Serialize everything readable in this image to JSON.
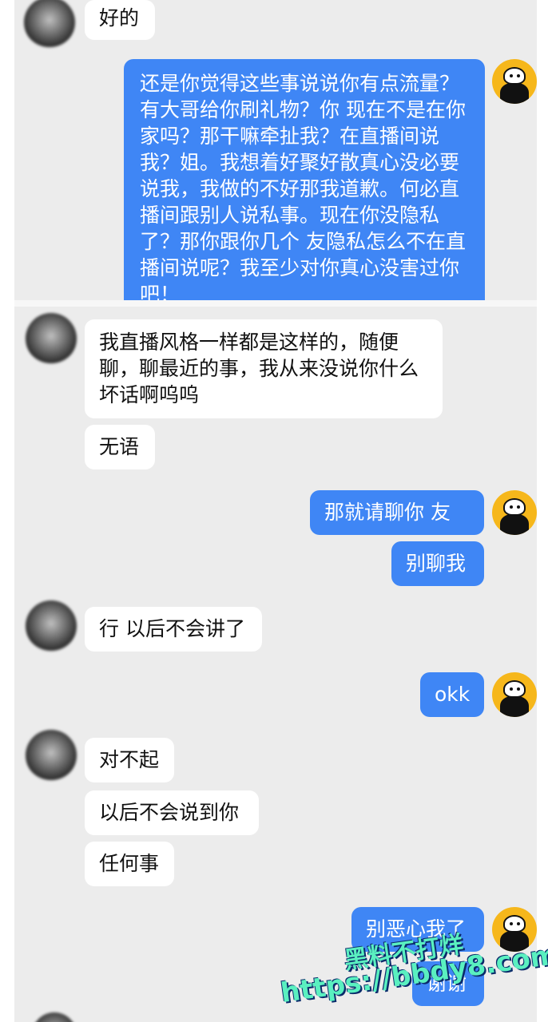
{
  "colors": {
    "outgoing_bubble": "#3f86f5",
    "incoming_bubble": "#ffffff",
    "background": "#ececec"
  },
  "messages": [
    {
      "side": "in",
      "text": "好的"
    },
    {
      "side": "out",
      "text": "还是你觉得这些事说说你有点流量？有大哥给你刷礼物？你  现在不是在你家吗？那干嘛牵扯我？在直播间说我？姐。我想着好聚好散真心没必要说我，我做的不好那我道歉。何必直播间跟别人说私事。现在你没隐私了？那你跟你几个 友隐私怎么不在直播间说呢？我至少对你真心没害过你吧！"
    },
    {
      "side": "in",
      "text": "我直播风格一样都是这样的，随便聊，聊最近的事，我从来没说你什么坏话啊呜呜"
    },
    {
      "side": "in",
      "text": "无语"
    },
    {
      "side": "out",
      "text": "那就请聊你  友"
    },
    {
      "side": "out",
      "text": "别聊我"
    },
    {
      "side": "in",
      "text": "行 以后不会讲了"
    },
    {
      "side": "out",
      "text": "okk"
    },
    {
      "side": "in",
      "text": "对不起"
    },
    {
      "side": "in",
      "text": "以后不会说到你"
    },
    {
      "side": "in",
      "text": "任何事"
    },
    {
      "side": "out",
      "text": "别恶心我了"
    },
    {
      "side": "out",
      "text": "谢谢"
    }
  ],
  "watermark": {
    "line1": "黑料不打烊",
    "line2": "https://bbdy8.com"
  }
}
